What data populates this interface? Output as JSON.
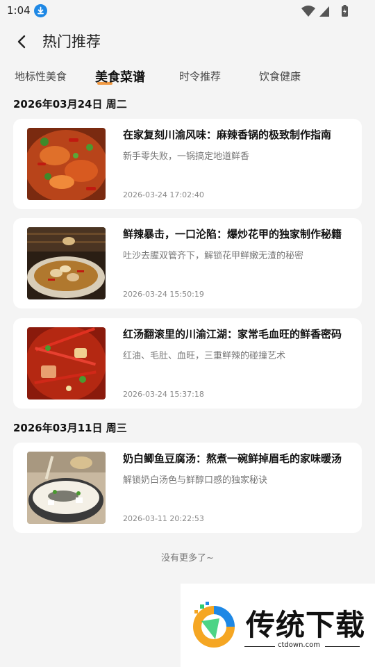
{
  "status_bar": {
    "time": "1:04"
  },
  "header": {
    "title": "热门推荐"
  },
  "tabs": [
    {
      "label": "地标性美食",
      "active": false
    },
    {
      "label": "美食菜谱",
      "active": true
    },
    {
      "label": "时令推荐",
      "active": false
    },
    {
      "label": "饮食健康",
      "active": false
    }
  ],
  "sections": [
    {
      "date": "2026年03月24日  周二",
      "articles": [
        {
          "title": "在家复刻川渝风味：麻辣香锅的极致制作指南",
          "subtitle": "新手零失败，一锅搞定地道鲜香",
          "time": "2026-03-24 17:02:40",
          "image": "spicy-pot-image"
        },
        {
          "title": "鲜辣暴击，一口沦陷：爆炒花甲的独家制作秘籍",
          "subtitle": "吐沙去腥双管齐下，解锁花甲鲜嫩无渣的秘密",
          "time": "2026-03-24 15:50:19",
          "image": "fried-clams-image"
        },
        {
          "title": "红汤翻滚里的川渝江湖：家常毛血旺的鲜香密码",
          "subtitle": "红油、毛肚、血旺，三重鲜辣的碰撞艺术",
          "time": "2026-03-24 15:37:18",
          "image": "maoxuewang-image"
        }
      ]
    },
    {
      "date": "2026年03月11日  周三",
      "articles": [
        {
          "title": "奶白鲫鱼豆腐汤：熬煮一碗鲜掉眉毛的家味暖汤",
          "subtitle": "解锁奶白汤色与鲜醇口感的独家秘诀",
          "time": "2026-03-11 20:22:53",
          "image": "fish-tofu-soup-image"
        }
      ]
    }
  ],
  "footer": {
    "no_more": "没有更多了~"
  },
  "watermark": {
    "name": "传统下载",
    "url": "ctdown.com"
  },
  "colors": {
    "accent": "#f08a24",
    "background": "#f4f4f4",
    "card": "#ffffff"
  }
}
